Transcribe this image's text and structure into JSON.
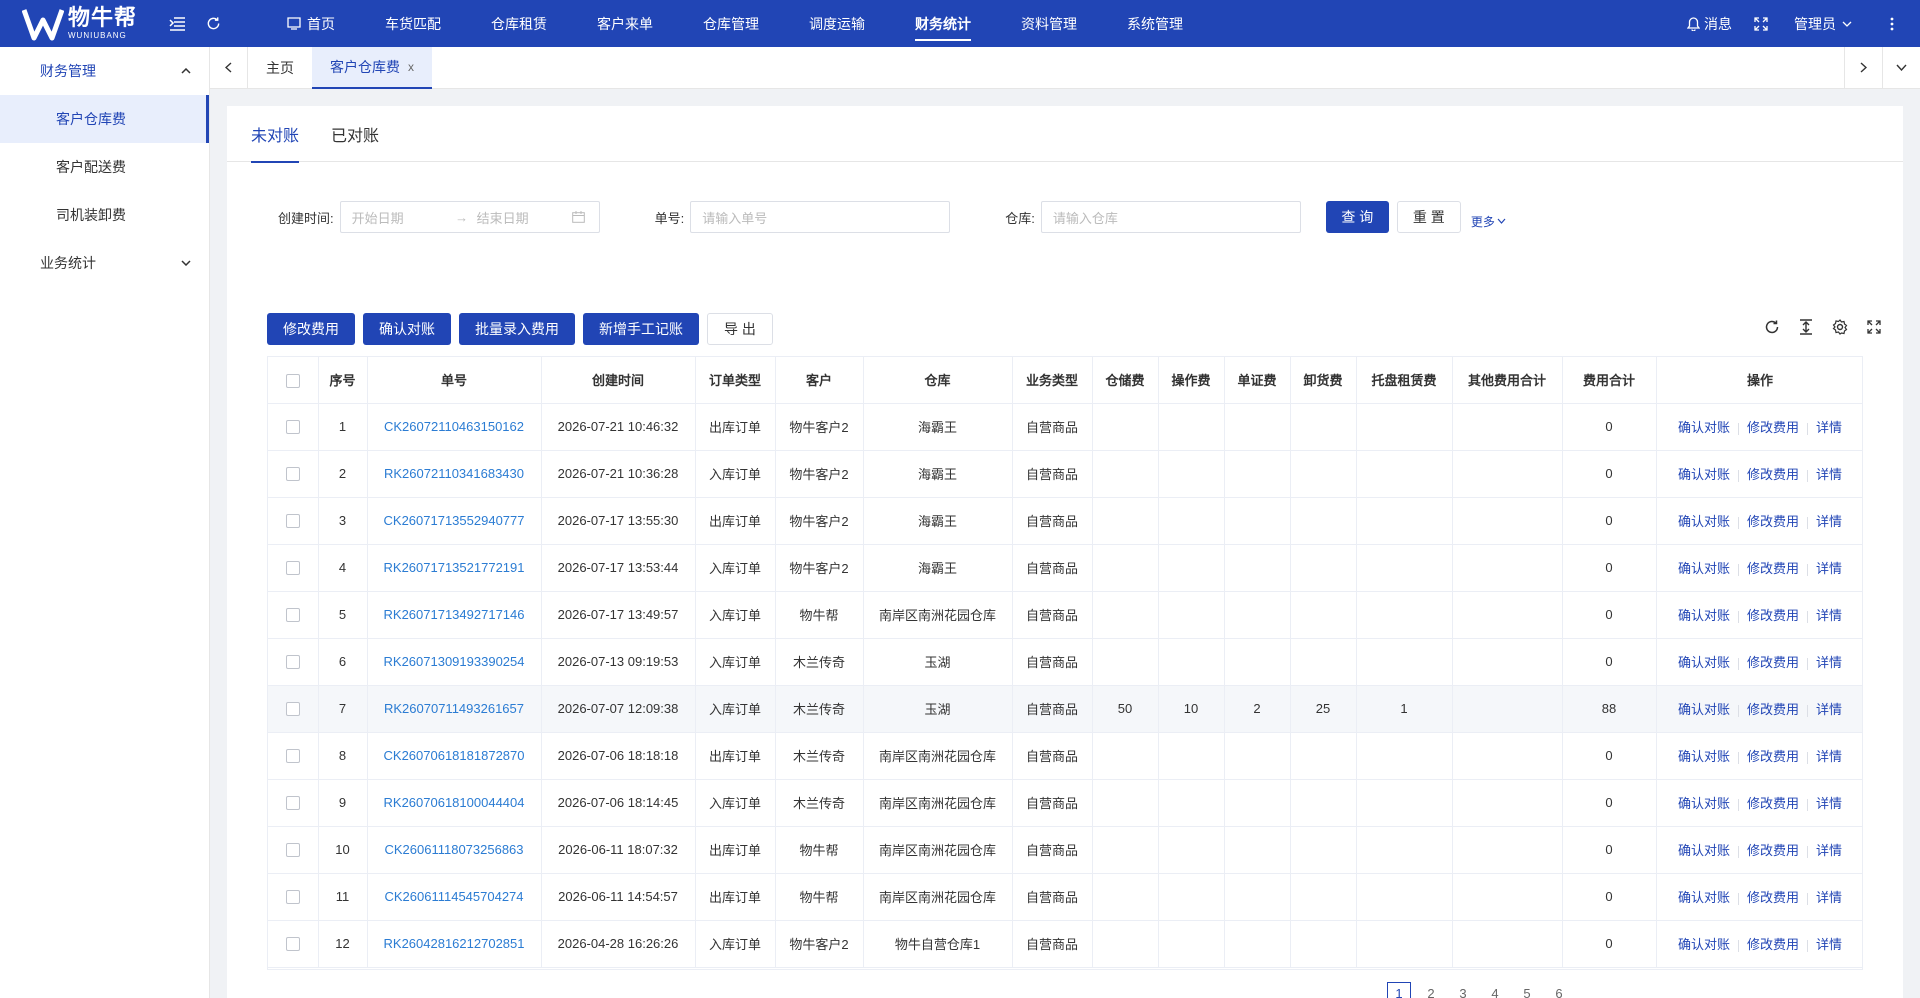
{
  "header": {
    "logo_cn": "物牛帮",
    "logo_en": "WUNIUBANG",
    "nav": [
      {
        "label": "首页",
        "active": false
      },
      {
        "label": "车货匹配",
        "active": false
      },
      {
        "label": "仓库租赁",
        "active": false
      },
      {
        "label": "客户来单",
        "active": false
      },
      {
        "label": "仓库管理",
        "active": false
      },
      {
        "label": "调度运输",
        "active": false
      },
      {
        "label": "财务统计",
        "active": true
      },
      {
        "label": "资料管理",
        "active": false
      },
      {
        "label": "系统管理",
        "active": false
      }
    ],
    "messages_label": "消息",
    "user_label": "管理员",
    "bg_color": "#2145b5"
  },
  "sidebar": {
    "group1": "财务管理",
    "items": [
      "客户仓库费",
      "客户配送费",
      "司机装卸费"
    ],
    "active_index": 0,
    "group2": "业务统计"
  },
  "tabs": {
    "home": "主页",
    "current": "客户仓库费",
    "close": "x"
  },
  "subtabs": [
    "未对账",
    "已对账"
  ],
  "filters": {
    "created_label": "创建时间:",
    "start_placeholder": "开始日期",
    "end_placeholder": "结束日期",
    "order_label": "单号:",
    "order_placeholder": "请输入单号",
    "warehouse_label": "仓库:",
    "warehouse_placeholder": "请输入仓库",
    "query": "查 询",
    "reset": "重 置",
    "more": "更多"
  },
  "actions": [
    "修改费用",
    "确认对账",
    "批量录入费用",
    "新增手工记账",
    "导 出"
  ],
  "table": {
    "columns": [
      "序号",
      "单号",
      "创建时间",
      "订单类型",
      "客户",
      "仓库",
      "业务类型",
      "仓储费",
      "操作费",
      "单证费",
      "卸货费",
      "托盘租赁费",
      "其他费用合计",
      "费用合计",
      "操作"
    ],
    "row_ops": [
      "确认对账",
      "修改费用",
      "详情"
    ],
    "rows": [
      {
        "no": "1",
        "order": "CK26072110463150162",
        "time": "2026-07-21 10:46:32",
        "type": "出库订单",
        "customer": "物牛客户2",
        "warehouse": "海霸王",
        "biz": "自营商品",
        "storage": "",
        "operate": "",
        "doc": "",
        "unload": "",
        "pallet": "",
        "other": "",
        "total": "0"
      },
      {
        "no": "2",
        "order": "RK26072110341683430",
        "time": "2026-07-21 10:36:28",
        "type": "入库订单",
        "customer": "物牛客户2",
        "warehouse": "海霸王",
        "biz": "自营商品",
        "storage": "",
        "operate": "",
        "doc": "",
        "unload": "",
        "pallet": "",
        "other": "",
        "total": "0"
      },
      {
        "no": "3",
        "order": "CK26071713552940777",
        "time": "2026-07-17 13:55:30",
        "type": "出库订单",
        "customer": "物牛客户2",
        "warehouse": "海霸王",
        "biz": "自营商品",
        "storage": "",
        "operate": "",
        "doc": "",
        "unload": "",
        "pallet": "",
        "other": "",
        "total": "0"
      },
      {
        "no": "4",
        "order": "RK26071713521772191",
        "time": "2026-07-17 13:53:44",
        "type": "入库订单",
        "customer": "物牛客户2",
        "warehouse": "海霸王",
        "biz": "自营商品",
        "storage": "",
        "operate": "",
        "doc": "",
        "unload": "",
        "pallet": "",
        "other": "",
        "total": "0"
      },
      {
        "no": "5",
        "order": "RK26071713492717146",
        "time": "2026-07-17 13:49:57",
        "type": "入库订单",
        "customer": "物牛帮",
        "warehouse": "南岸区南洲花园仓库",
        "biz": "自营商品",
        "storage": "",
        "operate": "",
        "doc": "",
        "unload": "",
        "pallet": "",
        "other": "",
        "total": "0"
      },
      {
        "no": "6",
        "order": "RK26071309193390254",
        "time": "2026-07-13 09:19:53",
        "type": "入库订单",
        "customer": "木兰传奇",
        "warehouse": "玉湖",
        "biz": "自营商品",
        "storage": "",
        "operate": "",
        "doc": "",
        "unload": "",
        "pallet": "",
        "other": "",
        "total": "0"
      },
      {
        "no": "7",
        "order": "RK26070711493261657",
        "time": "2026-07-07 12:09:38",
        "type": "入库订单",
        "customer": "木兰传奇",
        "warehouse": "玉湖",
        "biz": "自营商品",
        "storage": "50",
        "operate": "10",
        "doc": "2",
        "unload": "25",
        "pallet": "1",
        "other": "",
        "total": "88",
        "highlight": true
      },
      {
        "no": "8",
        "order": "CK26070618181872870",
        "time": "2026-07-06 18:18:18",
        "type": "出库订单",
        "customer": "木兰传奇",
        "warehouse": "南岸区南洲花园仓库",
        "biz": "自营商品",
        "storage": "",
        "operate": "",
        "doc": "",
        "unload": "",
        "pallet": "",
        "other": "",
        "total": "0"
      },
      {
        "no": "9",
        "order": "RK26070618100044404",
        "time": "2026-07-06 18:14:45",
        "type": "入库订单",
        "customer": "木兰传奇",
        "warehouse": "南岸区南洲花园仓库",
        "biz": "自营商品",
        "storage": "",
        "operate": "",
        "doc": "",
        "unload": "",
        "pallet": "",
        "other": "",
        "total": "0"
      },
      {
        "no": "10",
        "order": "CK26061118073256863",
        "time": "2026-06-11 18:07:32",
        "type": "出库订单",
        "customer": "物牛帮",
        "warehouse": "南岸区南洲花园仓库",
        "biz": "自营商品",
        "storage": "",
        "operate": "",
        "doc": "",
        "unload": "",
        "pallet": "",
        "other": "",
        "total": "0"
      },
      {
        "no": "11",
        "order": "CK26061114545704274",
        "time": "2026-06-11 14:54:57",
        "type": "出库订单",
        "customer": "物牛帮",
        "warehouse": "南岸区南洲花园仓库",
        "biz": "自营商品",
        "storage": "",
        "operate": "",
        "doc": "",
        "unload": "",
        "pallet": "",
        "other": "",
        "total": "0"
      },
      {
        "no": "12",
        "order": "RK26042816212702851",
        "time": "2026-04-28 16:26:26",
        "type": "入库订单",
        "customer": "物牛客户2",
        "warehouse": "物牛自营仓库1",
        "biz": "自营商品",
        "storage": "",
        "operate": "",
        "doc": "",
        "unload": "",
        "pallet": "",
        "other": "",
        "total": "0"
      }
    ]
  },
  "pager": {
    "pages": [
      "1",
      "2",
      "3",
      "4",
      "5",
      "6"
    ]
  }
}
